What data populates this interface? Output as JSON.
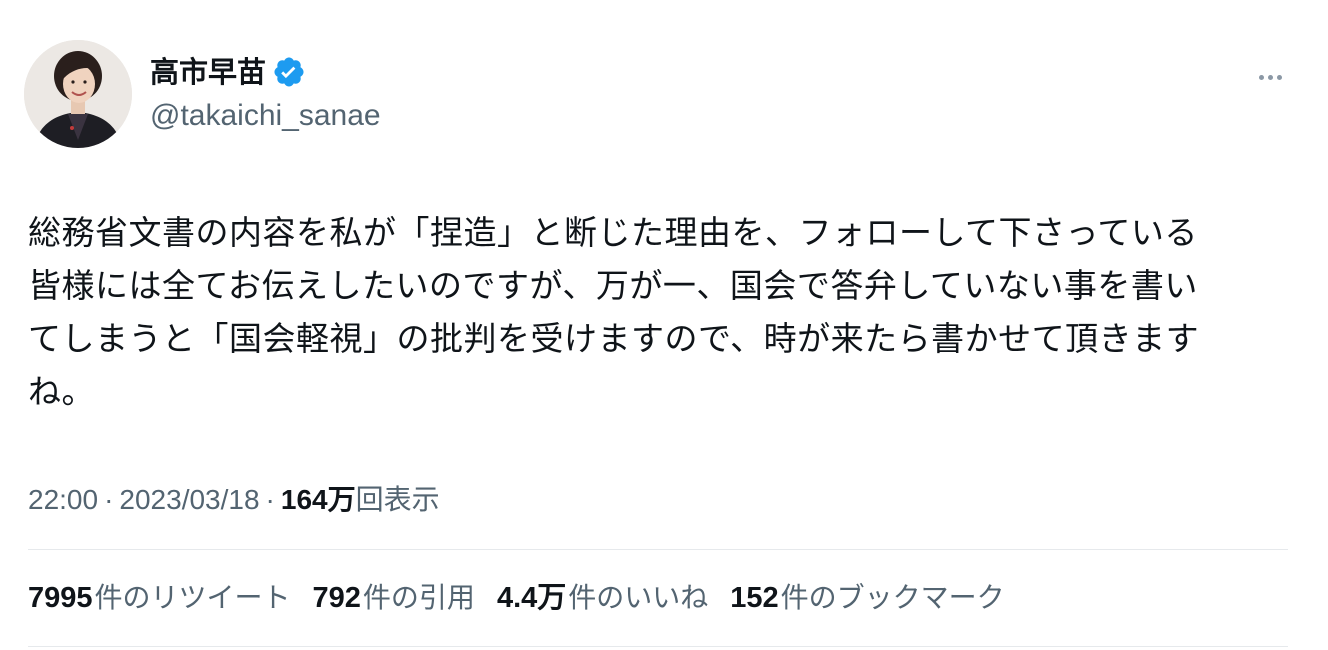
{
  "author": {
    "name": "高市早苗",
    "handle": "@takaichi_sanae",
    "verified_color": "#1d9bf0"
  },
  "tweet": {
    "text": "総務省文書の内容を私が「捏造」と断じた理由を、フォローして下さっている\n皆様には全てお伝えしたいのですが、万が一、国会で答弁していない事を書い\nてしまうと「国会軽視」の批判を受けますので、時が来たら書かせて頂きます\nね。"
  },
  "meta": {
    "time": "22:00",
    "separator": "·",
    "date": "2023/03/18",
    "views_count": "164万",
    "views_label": "回表示"
  },
  "stats": {
    "retweets": {
      "count": "7995",
      "label": "件のリツイート"
    },
    "quotes": {
      "count": "792",
      "label": "件の引用"
    },
    "likes": {
      "count": "4.4万",
      "label": "件のいいね"
    },
    "bookmarks": {
      "count": "152",
      "label": "件のブックマーク"
    }
  },
  "icons": {
    "avatar": "profile-photo",
    "verified": "verified-badge-icon",
    "more": "more-horizontal-icon"
  }
}
